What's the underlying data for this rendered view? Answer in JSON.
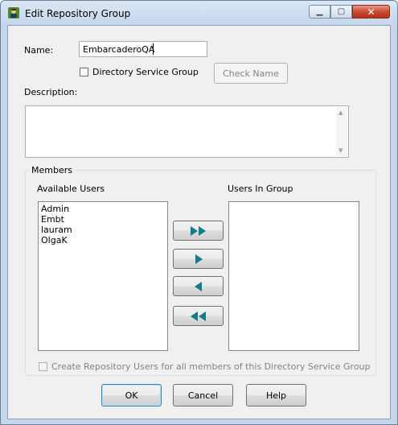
{
  "window": {
    "title": "Edit Repository Group"
  },
  "form": {
    "name_label": "Name:",
    "name_value": "EmbarcaderoQA",
    "directory_service_label": "Directory Service Group",
    "check_name_label": "Check Name",
    "description_label": "Description:",
    "description_value": ""
  },
  "members": {
    "group_label": "Members",
    "available_label": "Available Users",
    "in_group_label": "Users In Group",
    "available_users": [
      "Admin",
      "Embt",
      "lauram",
      "OlgaK"
    ],
    "users_in_group": [],
    "create_users_label": "Create Repository Users for all members of this Directory Service Group"
  },
  "buttons": {
    "ok": "OK",
    "cancel": "Cancel",
    "help": "Help"
  },
  "colors": {
    "arrow": "#0f7d8a",
    "title_bg": "#c6d7ec",
    "close_btn": "#c84a33"
  }
}
